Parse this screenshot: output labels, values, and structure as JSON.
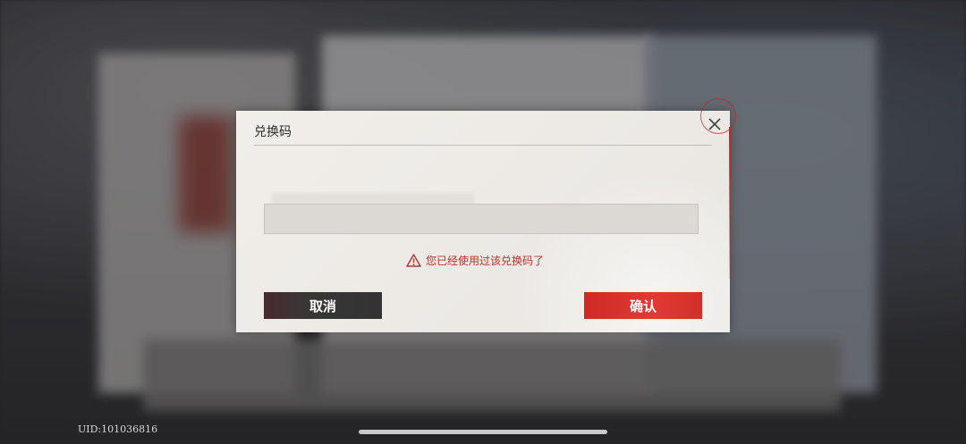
{
  "dialog": {
    "title": "兑换码",
    "input_value": "",
    "input_placeholder": "",
    "error_text": "您已经使用过该兑换码了",
    "cancel_label": "取消",
    "confirm_label": "确认"
  },
  "footer": {
    "uid": "UID:101036816"
  },
  "icons": {
    "close": "close-icon",
    "warning": "warning-icon"
  },
  "colors": {
    "accent_red": "#d22f2b",
    "error_text": "#c0302e",
    "cancel_button": "#333333",
    "dialog_bg": "#eeebe7"
  }
}
